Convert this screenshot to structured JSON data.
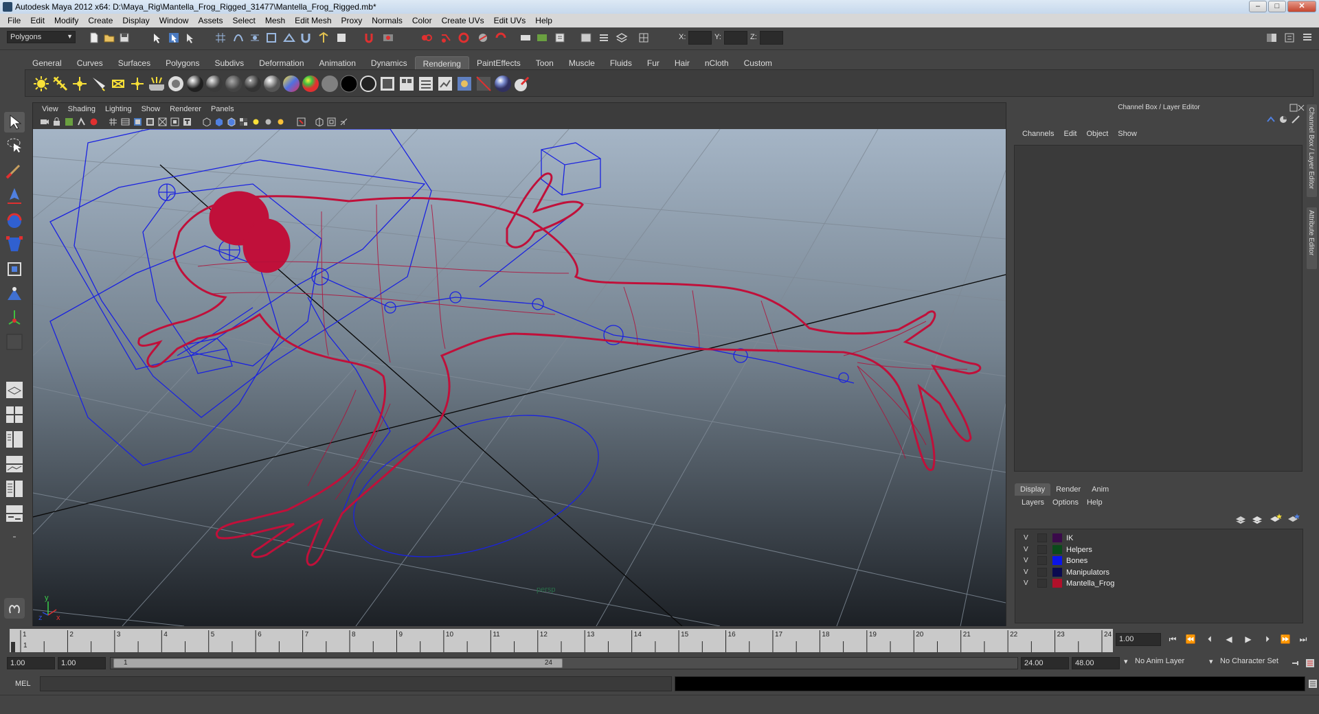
{
  "window": {
    "title": "Autodesk Maya 2012 x64: D:\\Maya_Rig\\Mantella_Frog_Rigged_31477\\Mantella_Frog_Rigged.mb*"
  },
  "menubar": [
    "File",
    "Edit",
    "Modify",
    "Create",
    "Display",
    "Window",
    "Assets",
    "Select",
    "Mesh",
    "Edit Mesh",
    "Proxy",
    "Normals",
    "Color",
    "Create UVs",
    "Edit UVs",
    "Help"
  ],
  "statusline": {
    "mode": "Polygons",
    "x_label": "X:",
    "y_label": "Y:",
    "z_label": "Z:"
  },
  "shelf": {
    "tabs": [
      "General",
      "Curves",
      "Surfaces",
      "Polygons",
      "Subdivs",
      "Deformation",
      "Animation",
      "Dynamics",
      "Rendering",
      "PaintEffects",
      "Toon",
      "Muscle",
      "Fluids",
      "Fur",
      "Hair",
      "nCloth",
      "Custom"
    ],
    "active_tab": "Rendering"
  },
  "viewport": {
    "menu": [
      "View",
      "Shading",
      "Lighting",
      "Show",
      "Renderer",
      "Panels"
    ],
    "camera": "persp",
    "axis_y": "y",
    "axis_x": "x",
    "axis_z": "z"
  },
  "channel_box": {
    "title": "Channel Box / Layer Editor",
    "menu": [
      "Channels",
      "Edit",
      "Object",
      "Show"
    ]
  },
  "layer_editor": {
    "tabs": [
      "Display",
      "Render",
      "Anim"
    ],
    "active_tab": "Display",
    "menu": [
      "Layers",
      "Options",
      "Help"
    ],
    "layers": [
      {
        "visible": "V",
        "name": "IK",
        "color": "#3a0a4a"
      },
      {
        "visible": "V",
        "name": "Helpers",
        "color": "#0a4a1a"
      },
      {
        "visible": "V",
        "name": "Bones",
        "color": "#0a14e8"
      },
      {
        "visible": "V",
        "name": "Manipulators",
        "color": "#0a0a50"
      },
      {
        "visible": "V",
        "name": "Mantella_Frog",
        "color": "#b0102a"
      }
    ]
  },
  "side_tabs": [
    "Channel Box / Layer Editor",
    "Attribute Editor"
  ],
  "time_slider": {
    "ticks": [
      "1",
      "2",
      "3",
      "4",
      "5",
      "6",
      "7",
      "8",
      "9",
      "10",
      "11",
      "12",
      "13",
      "14",
      "15",
      "16",
      "17",
      "18",
      "19",
      "20",
      "21",
      "22",
      "23",
      "24"
    ],
    "current_frame_marker": "1",
    "current_frame": "1.00"
  },
  "range_slider": {
    "start": "1.00",
    "playback_start": "1.00",
    "handle_start": "1",
    "handle_end": "24",
    "playback_end": "24.00",
    "end": "48.00",
    "anim_layer": "No Anim Layer",
    "character_set": "No Character Set"
  },
  "command_line": {
    "label": "MEL"
  },
  "colors": {
    "wireframe": "#c0103a",
    "rig": "#1a22e0",
    "grid": "#7f8a96"
  }
}
